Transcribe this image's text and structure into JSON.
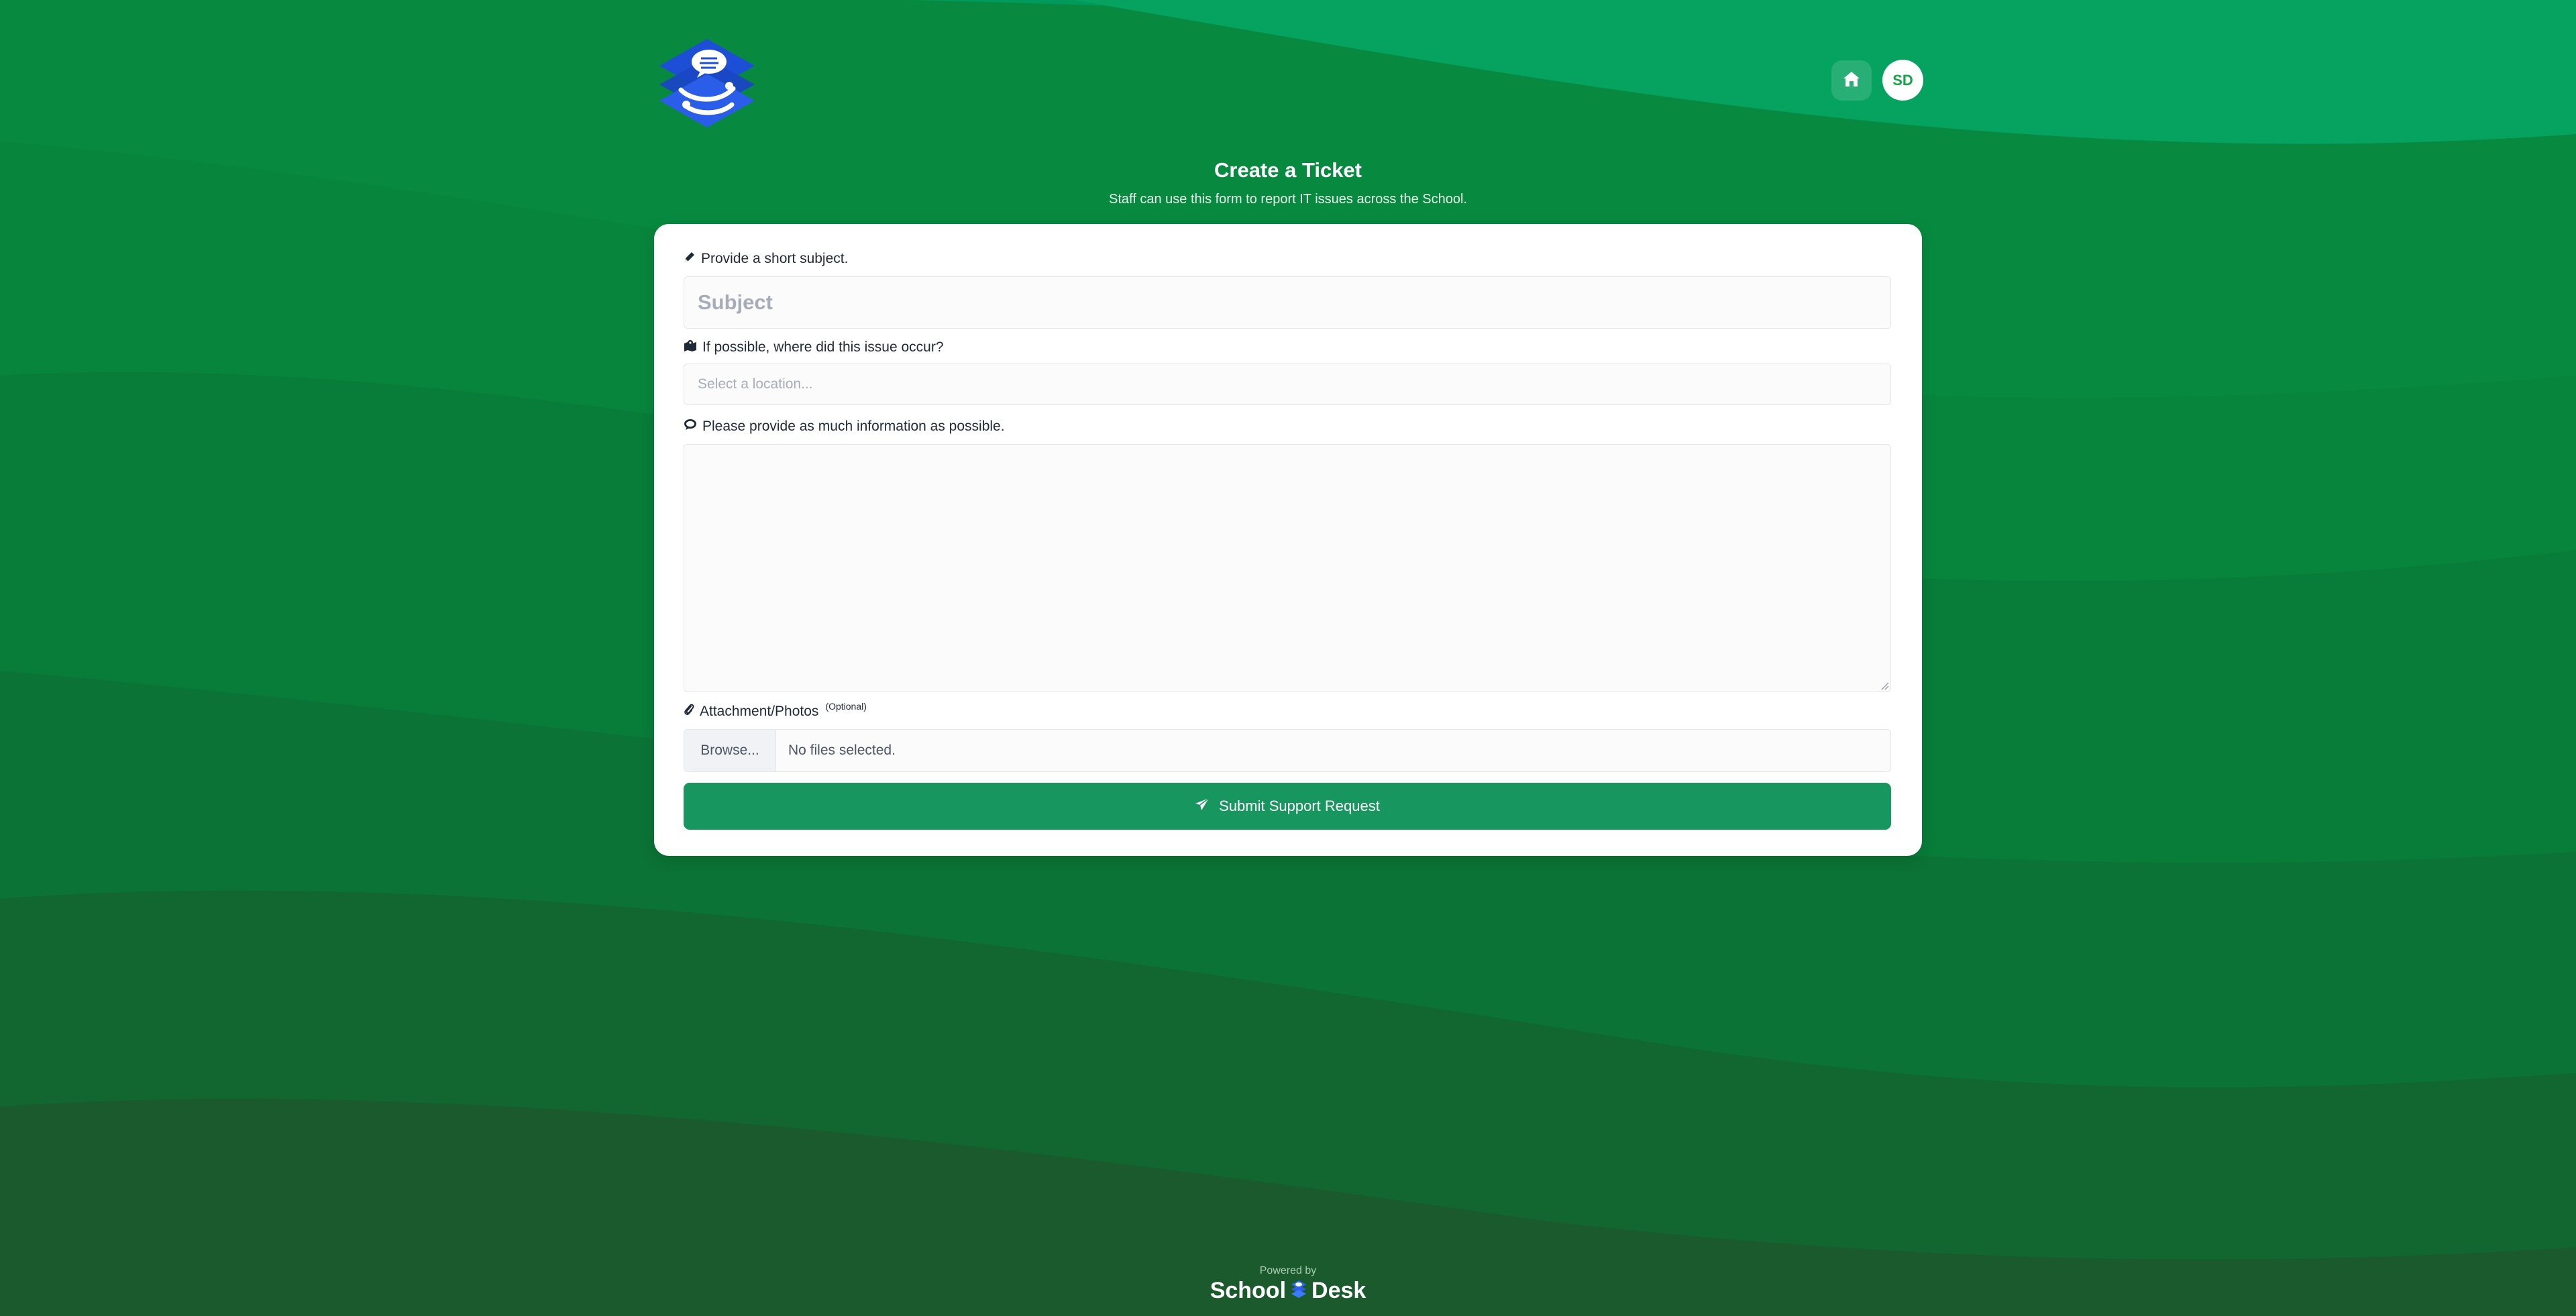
{
  "header": {
    "logo_icon": "schooldesk-logo-icon",
    "home_icon": "home-icon",
    "avatar_initials": "SD"
  },
  "page": {
    "title": "Create a Ticket",
    "subtitle": "Staff can use this form to report IT issues across the School."
  },
  "form": {
    "subject": {
      "icon": "pencil-icon",
      "label": "Provide a short subject.",
      "placeholder": "Subject",
      "value": ""
    },
    "location": {
      "icon": "map-icon",
      "label": "If possible, where did this issue occur?",
      "placeholder": "Select a location...",
      "value": ""
    },
    "details": {
      "icon": "comment-icon",
      "label": "Please provide as much information as possible.",
      "value": ""
    },
    "attachment": {
      "icon": "paperclip-icon",
      "label": "Attachment/Photos",
      "optional_label": "(Optional)",
      "browse_label": "Browse...",
      "status": "No files selected."
    },
    "submit": {
      "icon": "paper-plane-icon",
      "label": "Submit Support Request"
    }
  },
  "footer": {
    "powered_by": "Powered by",
    "brand_left": "School",
    "brand_right": "Desk"
  },
  "colors": {
    "background": "#0a7a3a",
    "card": "#ffffff",
    "submit_button": "#17975f",
    "avatar_text": "#16a34a",
    "logo_blue": "#1d4fd6"
  }
}
